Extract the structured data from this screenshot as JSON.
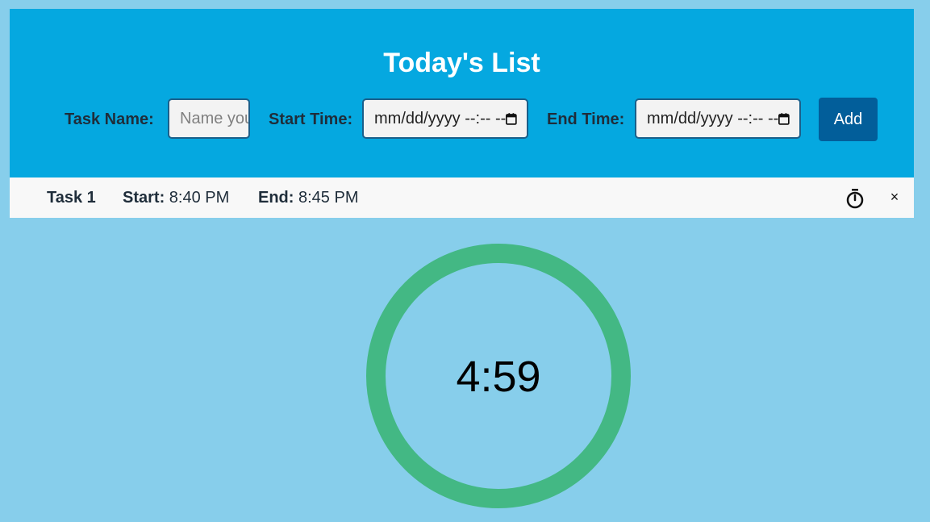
{
  "header": {
    "title": "Today's List",
    "task_name_label": "Task Name:",
    "task_name_placeholder": "Name your task",
    "start_time_label": "Start Time:",
    "start_time_value": "mm/dd/yyyy --:-- --",
    "end_time_label": "End Time:",
    "end_time_value": "mm/dd/yyyy --:-- --",
    "add_label": "Add"
  },
  "tasks": [
    {
      "name": "Task 1",
      "start_label": "Start:",
      "start_value": "8:40 PM",
      "end_label": "End:",
      "end_value": "8:45 PM",
      "timer_icon": "stopwatch-icon",
      "remove_label": "×"
    }
  ],
  "timer": {
    "display": "4:59",
    "progress": 1.0
  },
  "colors": {
    "background": "#87ceeb",
    "header": "#05a8e0",
    "add_button": "#025e9a",
    "ring": "#43b884"
  }
}
